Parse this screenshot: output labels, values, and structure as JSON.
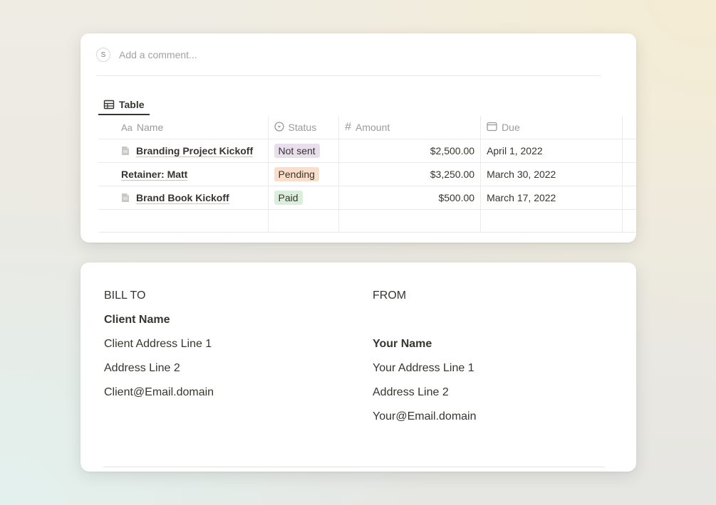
{
  "comment": {
    "avatar_initial": "S",
    "placeholder": "Add a comment..."
  },
  "view_tab": {
    "label": "Table",
    "icon": "table-icon"
  },
  "table": {
    "columns": [
      {
        "label": "Name",
        "icon": "Aa"
      },
      {
        "label": "Status",
        "icon": "status-icon"
      },
      {
        "label": "Amount",
        "icon": "#"
      },
      {
        "label": "Due",
        "icon": "calendar-icon"
      }
    ],
    "rows": [
      {
        "name": "Branding Project Kickoff",
        "has_page_icon": true,
        "status": "Not sent",
        "status_color": "#e8deee",
        "amount": "$2,500.00",
        "due": "April 1, 2022"
      },
      {
        "name": "Retainer: Matt",
        "has_page_icon": false,
        "status": "Pending",
        "status_color": "#fadec9",
        "amount": "$3,250.00",
        "due": "March 30, 2022"
      },
      {
        "name": "Brand Book Kickoff",
        "has_page_icon": true,
        "status": "Paid",
        "status_color": "#dbeddb",
        "amount": "$500.00",
        "due": "March 17, 2022"
      }
    ]
  },
  "bill_to": {
    "heading": "BILL TO",
    "name": "Client Name",
    "address1": "Client Address Line 1",
    "address2": "Address Line 2",
    "email": "Client@Email.domain"
  },
  "from": {
    "heading": "FROM",
    "name": "Your Name",
    "address1": "Your Address Line 1",
    "address2": "Address Line 2",
    "email": "Your@Email.domain"
  }
}
